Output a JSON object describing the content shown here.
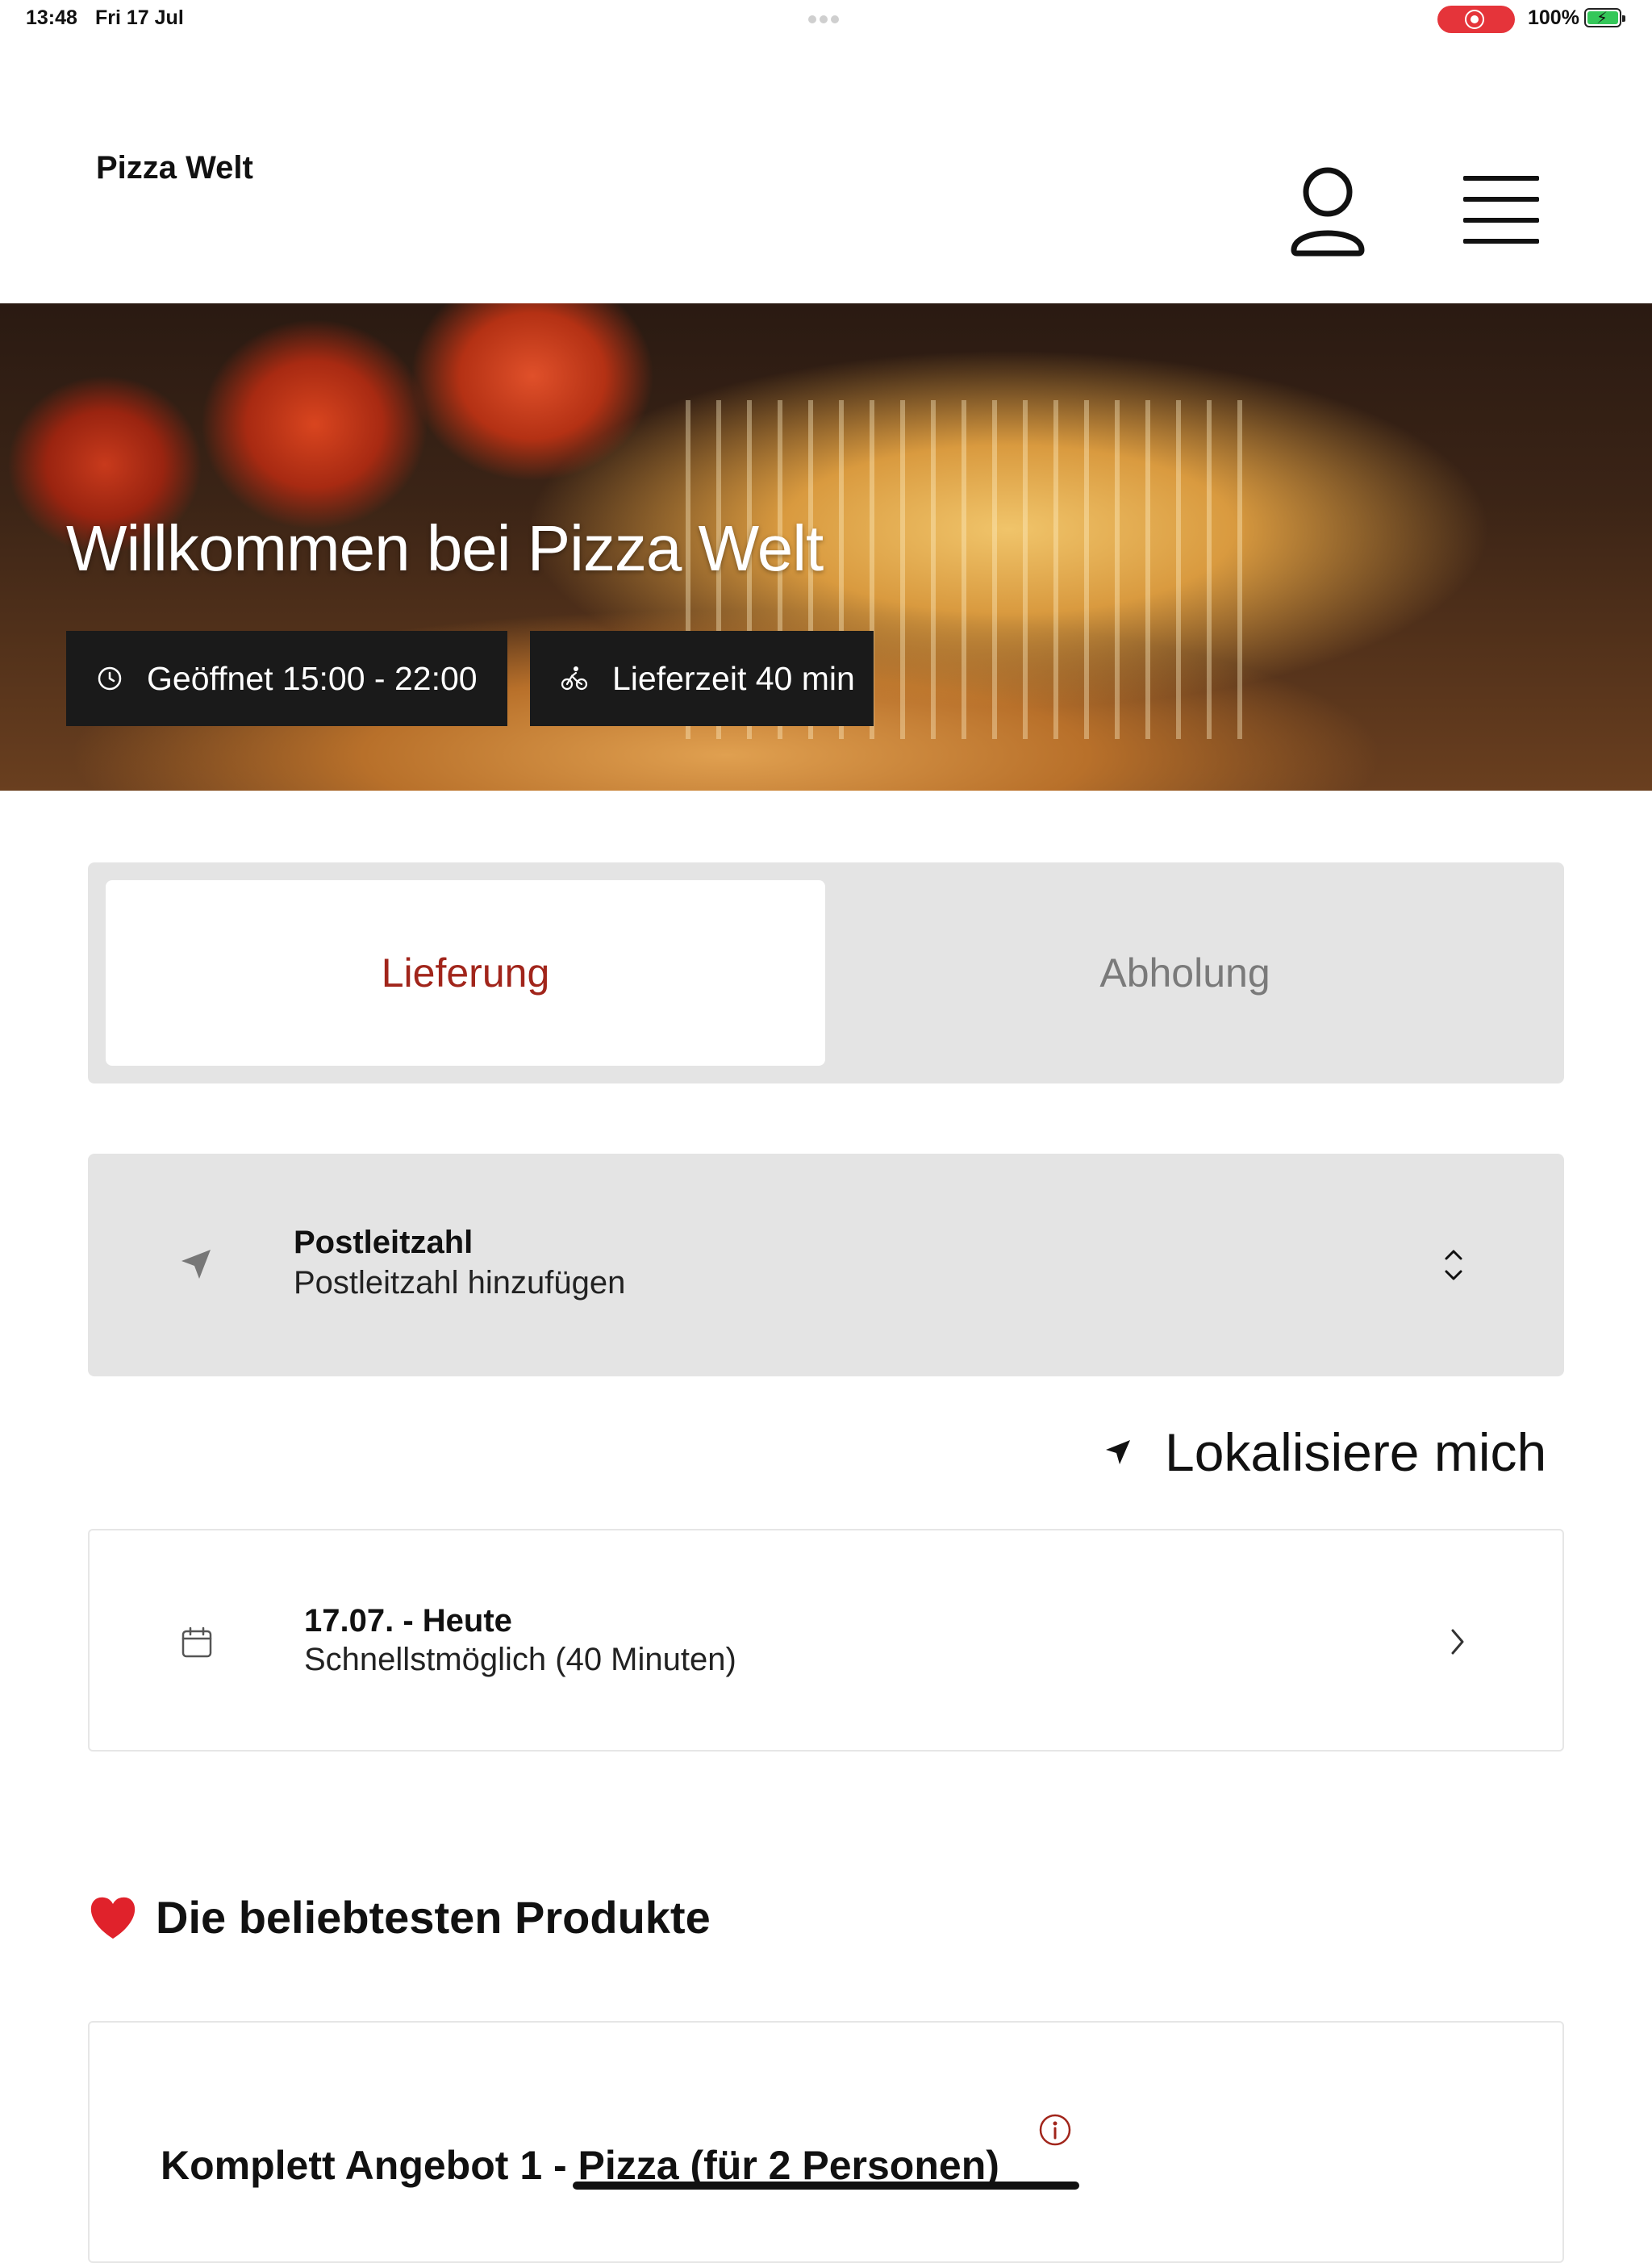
{
  "status_bar": {
    "time": "13:48",
    "date": "Fri 17 Jul",
    "battery_pct": "100%",
    "recording": true,
    "battery_level": 1.0
  },
  "header": {
    "brand": "Pizza Welt",
    "icons": [
      "user-icon",
      "menu-icon"
    ]
  },
  "hero": {
    "title": "Willkommen bei Pizza Welt",
    "open_hours": "Geöffnet 15:00 - 22:00",
    "delivery_time": "Lieferzeit 40 min",
    "icons": [
      "clock-icon",
      "bicycle-icon"
    ]
  },
  "tabs": [
    {
      "label": "Lieferung",
      "active": true
    },
    {
      "label": "Abholung",
      "active": false
    }
  ],
  "postal": {
    "title": "Postleitzahl",
    "placeholder": "Postleitzahl hinzufügen"
  },
  "locate": {
    "label": "Lokalisiere mich"
  },
  "schedule": {
    "title": "17.07. - Heute",
    "subtitle": "Schnellstmöglich (40 Minuten)"
  },
  "popular": {
    "title": "Die beliebtesten Produkte",
    "products": [
      {
        "name": "Komplett Angebot 1 - Pizza (für 2 Personen)"
      }
    ]
  },
  "colors": {
    "accent": "#a1251b",
    "tab_bg": "#e4e4e4",
    "badge_bg": "#1a1a1a",
    "record": "#e5343a",
    "battery": "#34c759"
  }
}
